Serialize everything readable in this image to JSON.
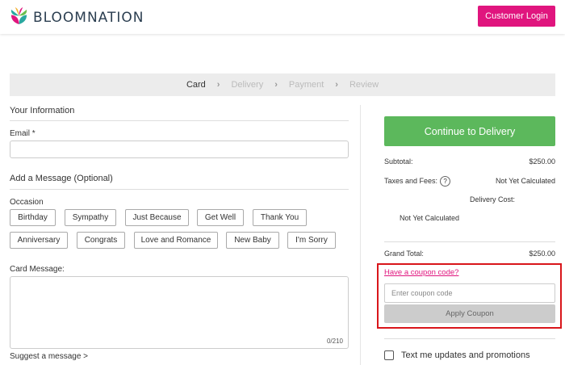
{
  "header": {
    "brand": "BLOOMNATION",
    "login_label": "Customer Login",
    "brand_colors": {
      "teal": "#2aa8a0",
      "pink": "#e0157e",
      "gold": "#f2b336",
      "green": "#6bbf4e"
    }
  },
  "steps": [
    "Card",
    "Delivery",
    "Payment",
    "Review"
  ],
  "your_info": {
    "title": "Your Information",
    "email_label": "Email *",
    "email_value": ""
  },
  "message": {
    "title": "Add a Message (Optional)",
    "occasion_label": "Occasion",
    "occasions_row1": [
      "Birthday",
      "Sympathy",
      "Just Because",
      "Get Well",
      "Thank You"
    ],
    "occasions_row2": [
      "Anniversary",
      "Congrats",
      "Love and Romance",
      "New Baby",
      "I'm Sorry"
    ],
    "card_message_label": "Card Message:",
    "char_count": "0/210",
    "suggest_link": "Suggest a message >"
  },
  "summary": {
    "continue_label": "Continue to Delivery",
    "subtotal_label": "Subtotal:",
    "subtotal_value": "$250.00",
    "taxes_label": "Taxes and Fees:",
    "help_icon": "?",
    "taxes_value": "Not Yet Calculated",
    "delivery_label": "Delivery Cost:",
    "delivery_value": "Not Yet Calculated",
    "grand_total_label": "Grand Total:",
    "grand_total_value": "$250.00"
  },
  "coupon": {
    "link_label": "Have a coupon code?",
    "placeholder": "Enter coupon code",
    "value": "",
    "apply_label": "Apply Coupon"
  },
  "sms": {
    "label": "Text me updates and promotions",
    "checked": false
  },
  "colors": {
    "accent_pink": "#e0157e",
    "continue_green": "#5cb85c",
    "highlight_red": "#d9161b"
  }
}
